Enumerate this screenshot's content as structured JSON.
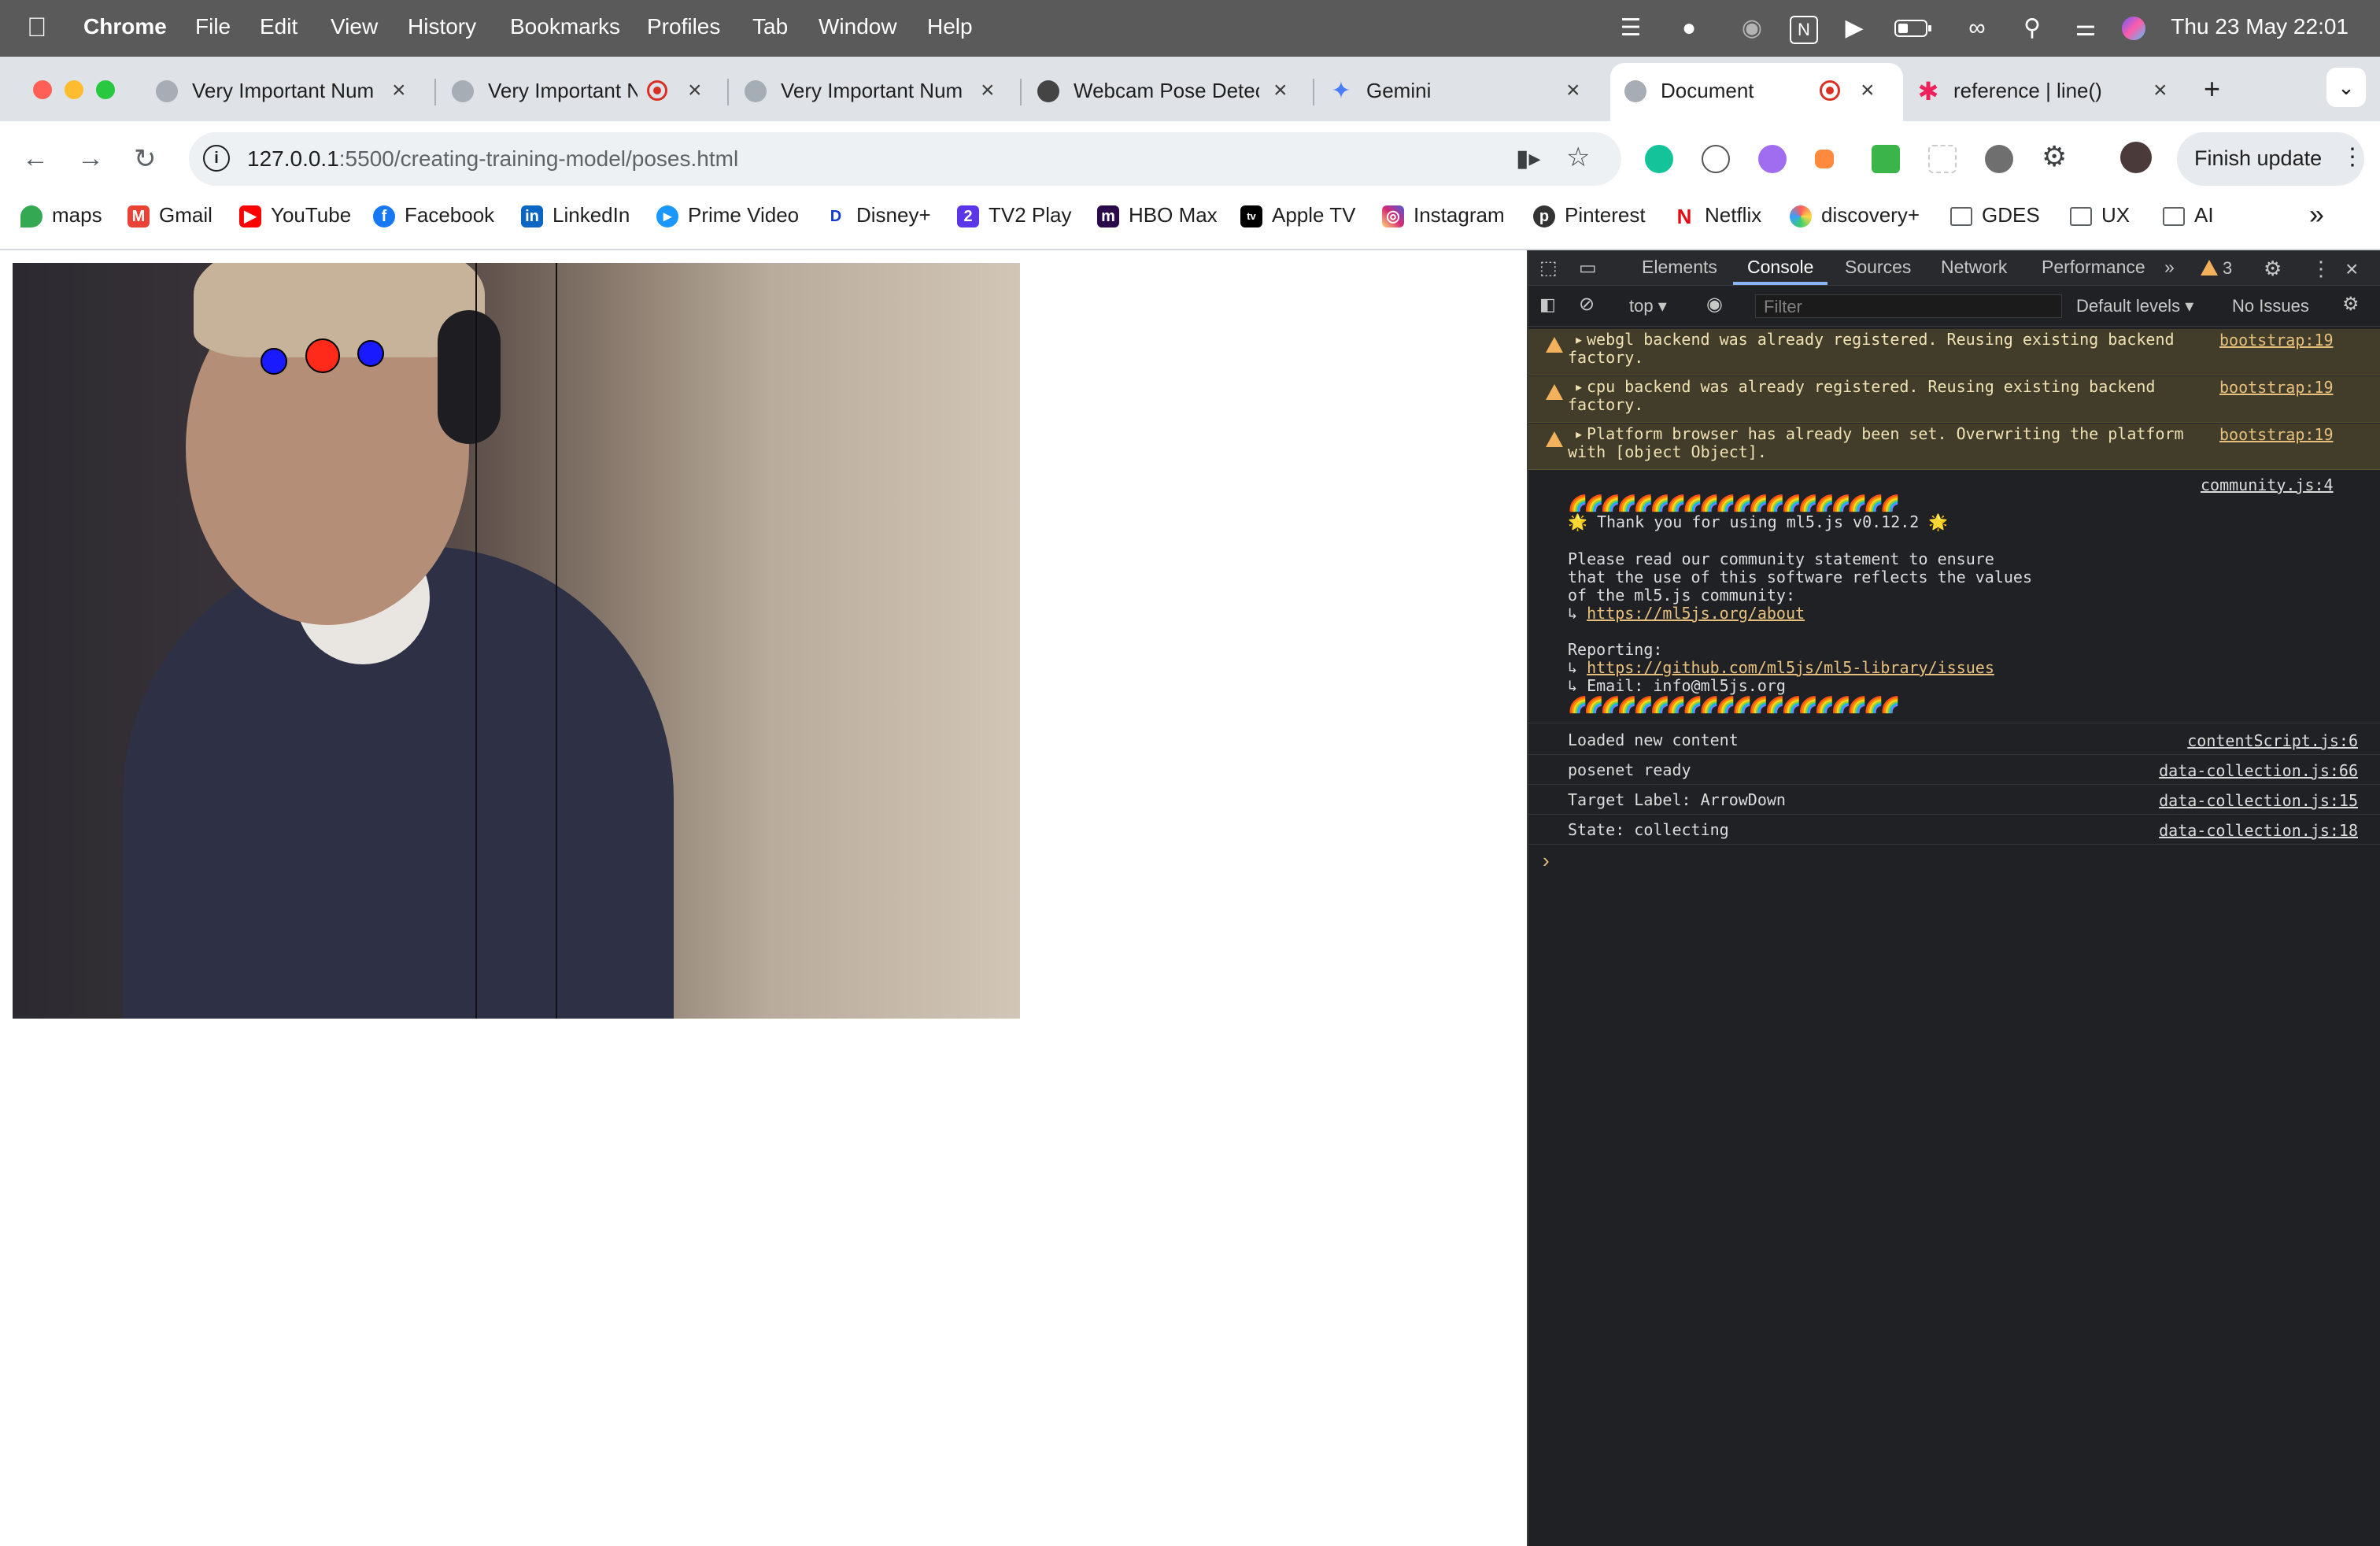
{
  "menubar": {
    "app_name": "Chrome",
    "menus": [
      "File",
      "Edit",
      "View",
      "History",
      "Bookmarks",
      "Profiles",
      "Tab",
      "Window",
      "Help"
    ],
    "clock": "Thu 23 May  22:01",
    "status_icons": [
      "stage-manager-icon",
      "wifi-calling-icon",
      "globe-icon",
      "notion-icon",
      "play-icon",
      "battery-icon",
      "link-icon",
      "search-icon",
      "control-center-icon",
      "siri-icon"
    ]
  },
  "tabs": [
    {
      "title": "Very Important Num",
      "recording": false
    },
    {
      "title": "Very Important N",
      "recording": true
    },
    {
      "title": "Very Important Num",
      "recording": false
    },
    {
      "title": "Webcam Pose Detec",
      "recording": false
    },
    {
      "title": "Gemini",
      "recording": false
    },
    {
      "title": "Document",
      "recording": true,
      "active": true
    },
    {
      "title": "reference | line()",
      "recording": false
    }
  ],
  "toolbar": {
    "url_host": "127.0.0.1",
    "url_path": ":5500/creating-training-model/poses.html",
    "finish_update_label": "Finish update"
  },
  "bookmarks": [
    {
      "label": "maps",
      "icon": "maps-icon"
    },
    {
      "label": "Gmail",
      "icon": "gmail-icon"
    },
    {
      "label": "YouTube",
      "icon": "youtube-icon"
    },
    {
      "label": "Facebook",
      "icon": "facebook-icon"
    },
    {
      "label": "LinkedIn",
      "icon": "linkedin-icon"
    },
    {
      "label": "Prime Video",
      "icon": "prime-video-icon"
    },
    {
      "label": "Disney+",
      "icon": "disney-icon"
    },
    {
      "label": "TV2 Play",
      "icon": "tv2-icon"
    },
    {
      "label": "HBO Max",
      "icon": "hbo-icon"
    },
    {
      "label": "Apple TV",
      "icon": "apple-tv-icon"
    },
    {
      "label": "Instagram",
      "icon": "instagram-icon"
    },
    {
      "label": "Pinterest",
      "icon": "pinterest-icon"
    },
    {
      "label": "Netflix",
      "icon": "netflix-icon"
    },
    {
      "label": "discovery+",
      "icon": "discovery-icon"
    },
    {
      "label": "GDES",
      "icon": "folder-icon"
    },
    {
      "label": "UX",
      "icon": "folder-icon"
    },
    {
      "label": "AI",
      "icon": "folder-icon"
    }
  ],
  "devtools": {
    "tabs": [
      "Elements",
      "Console",
      "Sources",
      "Network",
      "Performance"
    ],
    "active_tab": "Console",
    "warning_count": "3",
    "context": "top",
    "filter_placeholder": "Filter",
    "levels": "Default levels",
    "issues": "No Issues",
    "warnings": [
      {
        "line1": "webgl backend was already registered. Reusing existing backend",
        "line2": "factory.",
        "source": "bootstrap:19"
      },
      {
        "line1": "cpu backend was already registered. Reusing existing backend",
        "line2": "factory.",
        "source": "bootstrap:19"
      },
      {
        "line1": "Platform browser has already been set. Overwriting the platform",
        "line2": "with [object Object].",
        "source": "bootstrap:19"
      }
    ],
    "community": {
      "source": "community.js:4",
      "rainbow": "🌈🌈🌈🌈🌈🌈🌈🌈🌈🌈🌈🌈🌈🌈🌈🌈🌈🌈🌈🌈",
      "thanks": "🌟 Thank you for using ml5.js v0.12.2 🌟",
      "p1": "Please read our community statement to ensure",
      "p2": "that the use of this software reflects the values",
      "p3": "of the ml5.js community:",
      "about_prefix": "↳ ",
      "about_link": "https://ml5js.org/about",
      "reporting": "Reporting:",
      "issues_prefix": "↳ ",
      "issues_link": "https://github.com/ml5js/ml5-library/issues",
      "email": "↳ Email: info@ml5js.org"
    },
    "logs": [
      {
        "text": "Loaded new content",
        "source": "contentScript.js:6"
      },
      {
        "text": "posenet ready",
        "source": "data-collection.js:66"
      },
      {
        "text": "Target Label: ArrowDown",
        "source": "data-collection.js:15"
      },
      {
        "text": "State: collecting",
        "source": "data-collection.js:18"
      }
    ],
    "prompt": "›"
  }
}
